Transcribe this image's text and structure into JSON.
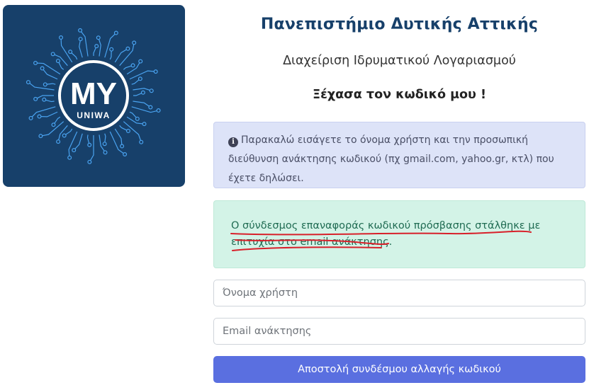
{
  "logo": {
    "text_main": "MY",
    "text_sub": "UNIWA",
    "background_color": "#17406a",
    "accent_color": "#4aa3f0"
  },
  "header": {
    "university_name": "Πανεπιστήμιο Δυτικής Αττικής",
    "subtitle": "Διαχείριση Ιδρυματικού Λογαριασμού",
    "page_title": "Ξέχασα τον κωδικό μου !"
  },
  "info_alert": {
    "icon": "info-circle-icon",
    "text": "Παρακαλώ εισάγετε το όνομα χρήστη και την προσωπική διεύθυνση ανάκτησης κωδικού (πχ gmail.com, yahoo.gr, κτλ) που έχετε δηλώσει."
  },
  "success_alert": {
    "text": "Ο σύνδεσμος επαναφοράς κωδικού πρόσβασης στάλθηκε με επιτυχία στο email ανάκτησης.",
    "annotation_color": "#d8202a"
  },
  "form": {
    "username_placeholder": "Όνομα χρήστη",
    "username_value": "",
    "email_placeholder": "Email ανάκτησης",
    "email_value": "",
    "submit_label": "Αποστολή συνδέσμου αλλαγής κωδικού"
  },
  "colors": {
    "title": "#17406a",
    "info_bg": "#dde3f8",
    "success_bg": "#d3f3e7",
    "button": "#5a6fe0"
  }
}
